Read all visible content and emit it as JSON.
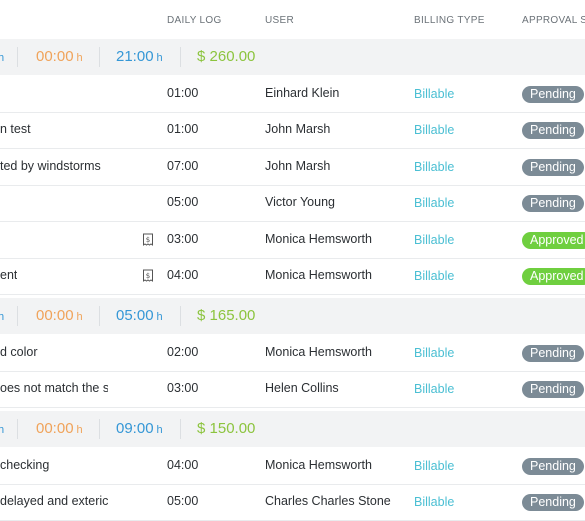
{
  "header": {
    "daily_log": "DAILY LOG",
    "user": "USER",
    "billing_type": "BILLING TYPE",
    "approval_status": "APPROVAL ST"
  },
  "groups": [
    {
      "lead": "h",
      "time1": "00:00",
      "unit1": "h",
      "time2": "21:00",
      "unit2": "h",
      "amount": "$ 260.00",
      "rows": [
        {
          "title": "",
          "log": "01:00",
          "user": "Einhard Klein",
          "billing": "Billable",
          "status": "Pending",
          "status_type": "pending",
          "icon": false
        },
        {
          "title": "n test",
          "log": "01:00",
          "user": "John Marsh",
          "billing": "Billable",
          "status": "Pending",
          "status_type": "pending",
          "icon": false
        },
        {
          "title": "ted by windstorms",
          "log": "07:00",
          "user": "John Marsh",
          "billing": "Billable",
          "status": "Pending",
          "status_type": "pending",
          "icon": false
        },
        {
          "title": "",
          "log": "05:00",
          "user": "Victor Young",
          "billing": "Billable",
          "status": "Pending",
          "status_type": "pending",
          "icon": false
        },
        {
          "title": "",
          "log": "03:00",
          "user": "Monica Hemsworth",
          "billing": "Billable",
          "status": "Approved",
          "status_type": "approved",
          "icon": true
        },
        {
          "title": "ent",
          "log": "04:00",
          "user": "Monica Hemsworth",
          "billing": "Billable",
          "status": "Approved",
          "status_type": "approved",
          "icon": true
        }
      ]
    },
    {
      "lead": "h",
      "time1": "00:00",
      "unit1": "h",
      "time2": "05:00",
      "unit2": "h",
      "amount": "$ 165.00",
      "rows": [
        {
          "title": "d color",
          "log": "02:00",
          "user": "Monica Hemsworth",
          "billing": "Billable",
          "status": "Pending",
          "status_type": "pending",
          "icon": false
        },
        {
          "title": "oes not match the sp",
          "log": "03:00",
          "user": "Helen Collins",
          "billing": "Billable",
          "status": "Pending",
          "status_type": "pending",
          "icon": false
        }
      ]
    },
    {
      "lead": "h",
      "time1": "00:00",
      "unit1": "h",
      "time2": "09:00",
      "unit2": "h",
      "amount": "$ 150.00",
      "rows": [
        {
          "title": "checking",
          "log": "04:00",
          "user": "Monica Hemsworth",
          "billing": "Billable",
          "status": "Pending",
          "status_type": "pending",
          "icon": false
        },
        {
          "title": "delayed and exteric",
          "log": "05:00",
          "user": "Charles Charles Stone",
          "billing": "Billable",
          "status": "Pending",
          "status_type": "pending",
          "icon": false
        }
      ]
    }
  ]
}
